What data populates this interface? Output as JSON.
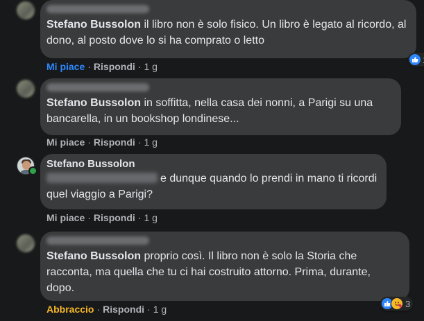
{
  "comments": [
    {
      "author": "Stefano Bussolon",
      "text": " il libro non è solo fisico. Un libro è legato al ricordo, al dono, al posto dove lo si ha comprato o letto",
      "actions": {
        "react": "Mi piace",
        "reply": "Rispondi",
        "time": "1 g"
      },
      "reactions": {
        "count": "1",
        "icons": [
          "like-icon"
        ]
      }
    },
    {
      "author": "Stefano Bussolon",
      "text": " in soffitta, nella casa dei nonni, a Parigi su una bancarella, in un bookshop londinese...",
      "actions": {
        "react": "Mi piace",
        "reply": "Rispondi",
        "time": "1 g"
      }
    },
    {
      "author": "Stefano Bussolon",
      "text": "e dunque quando lo prendi in mano ti ricordi quel viaggio a Parigi?",
      "actions": {
        "react": "Mi piace",
        "reply": "Rispondi",
        "time": "1 g"
      }
    },
    {
      "author": "Stefano Bussolon",
      "text": " proprio così. Il libro non è solo la Storia che racconta, ma quella che tu ci hai costruito attorno. Prima, durante, dopo.",
      "actions": {
        "react": "Abbraccio",
        "reply": "Rispondi",
        "time": "1 g"
      },
      "reactions": {
        "count": "3",
        "icons": [
          "like-icon",
          "hug-icon"
        ]
      }
    }
  ],
  "colors": {
    "background": "#18191a",
    "bubble": "#3a3b3c",
    "text": "#e4e6eb",
    "secondary": "#b0b3b8",
    "like": "#2d88ff",
    "hug": "#f7b928",
    "online": "#31a24c"
  }
}
